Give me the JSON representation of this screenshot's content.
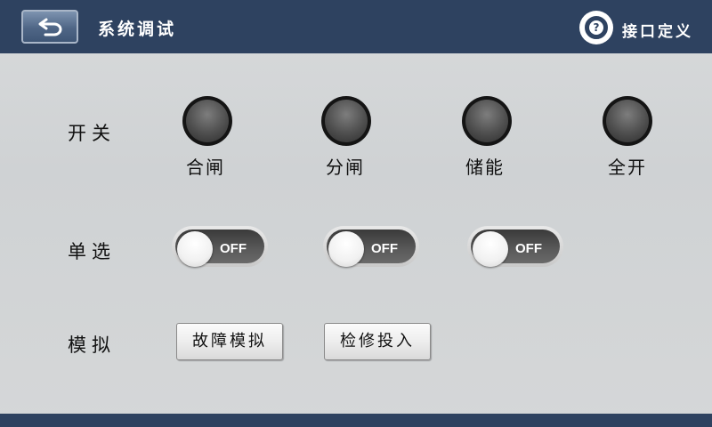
{
  "header": {
    "title": "系统调试",
    "help_label": "接口定义",
    "help_icon_glyph": "?"
  },
  "rows": {
    "switch_label": "开关",
    "radio_label": "单选",
    "sim_label": "模拟"
  },
  "lamps": [
    {
      "label": "合闸"
    },
    {
      "label": "分闸"
    },
    {
      "label": "储能"
    },
    {
      "label": "全开"
    }
  ],
  "toggles": [
    {
      "state": "OFF"
    },
    {
      "state": "OFF"
    },
    {
      "state": "OFF"
    }
  ],
  "buttons": {
    "fault_sim": "故障模拟",
    "maint_in": "检修投入"
  },
  "colors": {
    "header_bg": "#2e4260",
    "body_bg": "#d4d6d7"
  }
}
